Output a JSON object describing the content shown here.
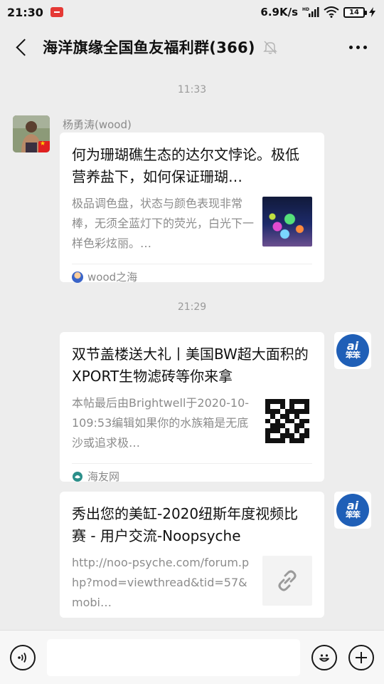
{
  "status_bar": {
    "time": "21:30",
    "net_speed": "6.9K/s",
    "network_type": "HD",
    "battery": "14"
  },
  "header": {
    "title": "海洋旗缘全国鱼友福利群(366)"
  },
  "messages": [
    {
      "timestamp": "11:33",
      "sender": "杨勇涛(wood)",
      "title": "何为珊瑚礁生态的达尔文悖论。极低营养盐下，如何保证珊瑚…",
      "description": "极品调色盘，状态与颜色表现非常棒，无须全蓝灯下的荧光，白光下一样色彩炫丽。…",
      "source": "wood之海"
    },
    {
      "timestamp": "21:29",
      "title": "双节盖楼送大礼丨美国BW超大面积的XPORT生物滤砖等你来拿",
      "description": "本帖最后由Brightwell于2020-10-109:53编辑如果你的水族箱是无底沙或追求极…",
      "source": "海友网"
    },
    {
      "title": "秀出您的美缸-2020纽斯年度视频比赛 - 用户交流-Noopsyche",
      "description": "http://noo-psyche.com/forum.php?mod=viewthread&tid=57&mobi…"
    }
  ],
  "ai_avatar": {
    "line1": "ai",
    "line2": "笨笨"
  },
  "input": {
    "placeholder": ""
  },
  "colors": {
    "background": "#ededed",
    "card": "#ffffff",
    "ai_blue": "#1f5fb7"
  }
}
